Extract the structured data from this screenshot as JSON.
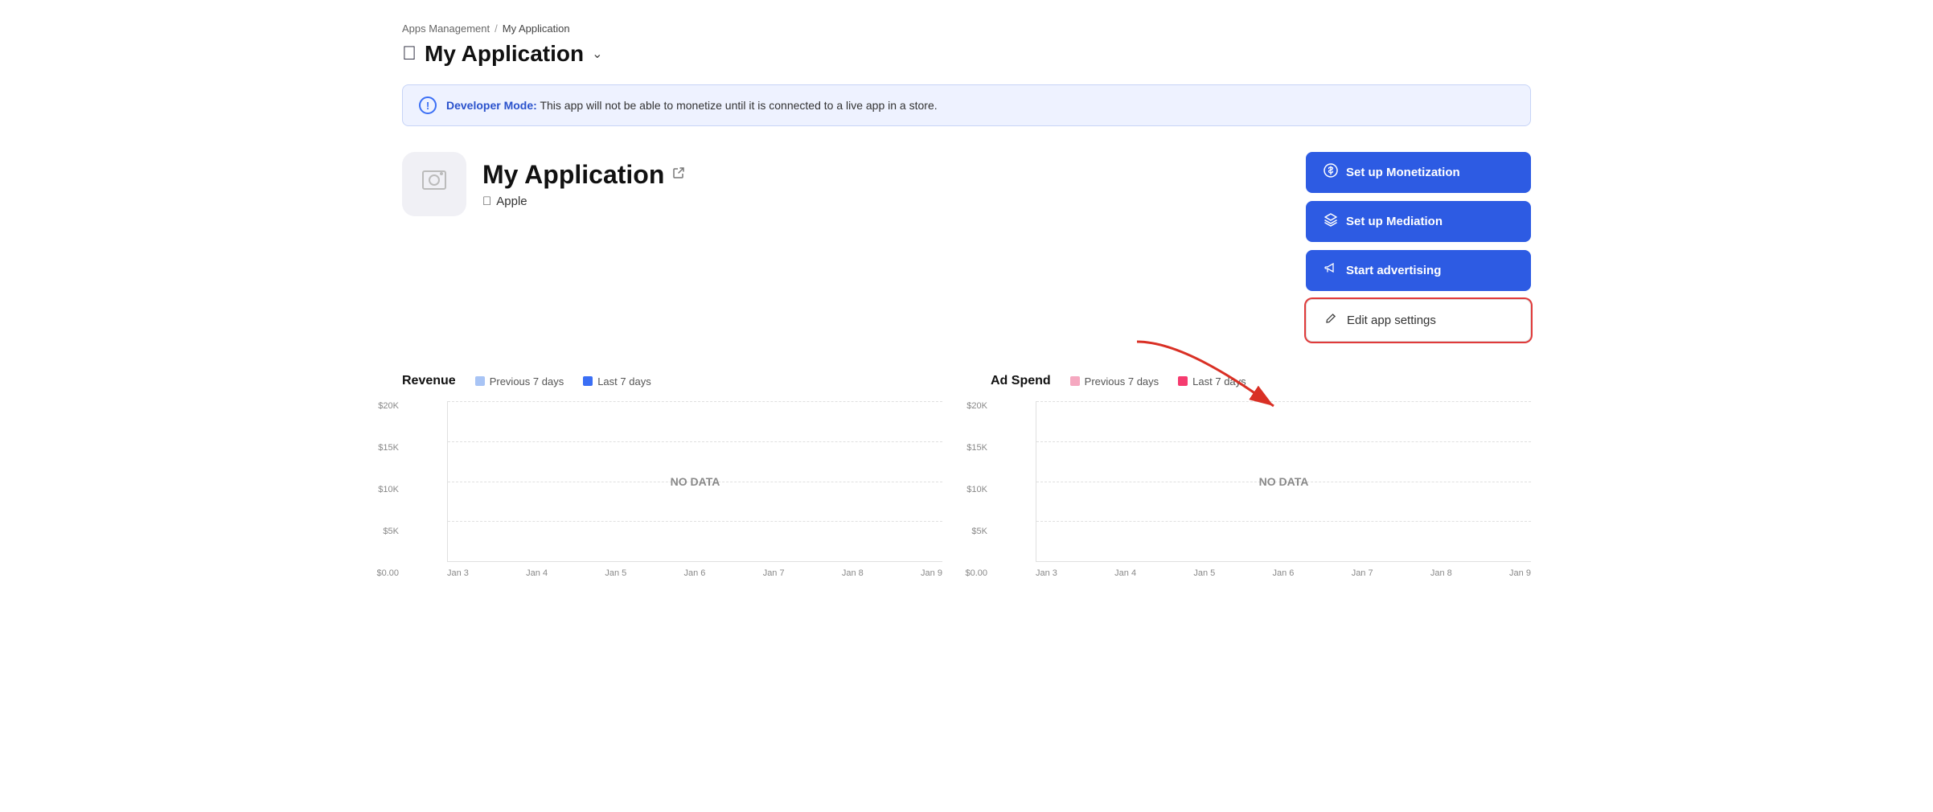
{
  "breadcrumb": {
    "parent": "Apps Management",
    "separator": "/",
    "current": "My Application"
  },
  "page_title": {
    "apple_icon": "",
    "title": "My Application",
    "chevron": "∨"
  },
  "banner": {
    "label": "Developer Mode:",
    "text": " This app will not be able to monetize until it is connected to a live app in a store."
  },
  "app": {
    "name": "My Application",
    "platform": "Apple"
  },
  "buttons": {
    "monetization": "Set up Monetization",
    "mediation": "Set up Mediation",
    "advertising": "Start advertising",
    "edit_settings": "Edit app settings"
  },
  "revenue_chart": {
    "title": "Revenue",
    "legend": [
      {
        "label": "Previous 7 days",
        "color": "#a8c4f5"
      },
      {
        "label": "Last 7 days",
        "color": "#3b6ff5"
      }
    ],
    "no_data": "NO DATA",
    "y_labels": [
      "$20K",
      "$15K",
      "$10K",
      "$5K",
      "$0.00"
    ],
    "x_labels": [
      "Jan 3",
      "Jan 4",
      "Jan 5",
      "Jan 6",
      "Jan 7",
      "Jan 8",
      "Jan 9"
    ]
  },
  "ad_spend_chart": {
    "title": "Ad Spend",
    "legend": [
      {
        "label": "Previous 7 days",
        "color": "#f5a8c0"
      },
      {
        "label": "Last 7 days",
        "color": "#f53b6f"
      }
    ],
    "no_data": "NO DATA",
    "y_labels": [
      "$20K",
      "$15K",
      "$10K",
      "$5K",
      "$0.00"
    ],
    "x_labels": [
      "Jan 3",
      "Jan 4",
      "Jan 5",
      "Jan 6",
      "Jan 7",
      "Jan 8",
      "Jan 9"
    ]
  }
}
